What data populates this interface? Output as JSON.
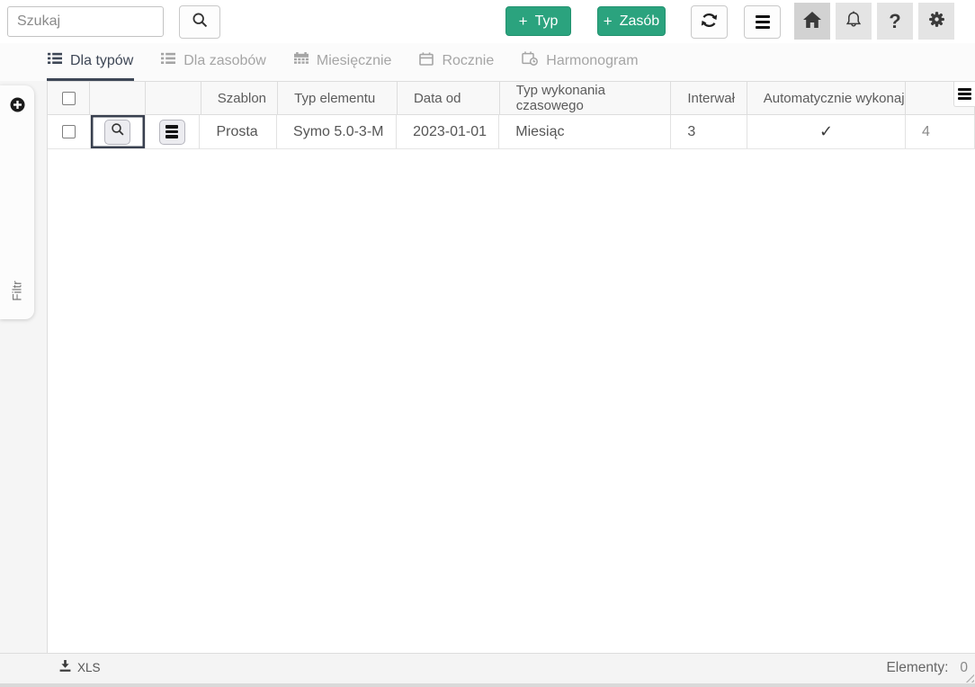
{
  "icons": {
    "plus": "+",
    "check": "✓",
    "question": "?"
  },
  "topbar": {
    "search_placeholder": "Szukaj",
    "typ_button_label": "Typ",
    "zasob_button_label": "Zasób"
  },
  "tabs": [
    {
      "label": "Dla typów",
      "active": true
    },
    {
      "label": "Dla zasobów",
      "active": false
    },
    {
      "label": "Miesięcznie",
      "active": false
    },
    {
      "label": "Rocznie",
      "active": false
    },
    {
      "label": "Harmonogram",
      "active": false
    }
  ],
  "filter_panel": {
    "label": "Filtr"
  },
  "grid": {
    "headers": [
      "",
      "",
      "",
      "Szablon",
      "Typ elementu",
      "Data od",
      "Typ wykonania czasowego",
      "Interwał",
      "Automatycznie wykonaj",
      ""
    ],
    "rows": [
      {
        "szablon": "Prosta",
        "typ_elementu": "Symo 5.0-3-M",
        "data_od": "2023-01-01",
        "typ_wykonania_czasowego": "Miesiąc",
        "interwal": "3",
        "automatycznie_wykonaj": true,
        "trailing_value": "4"
      }
    ]
  },
  "footer": {
    "xls_label": "XLS",
    "elements_label": "Elementy:",
    "elements_count": "0"
  },
  "colors": {
    "accent_green": "#2ba37e",
    "accent_dark": "#3e4756"
  }
}
